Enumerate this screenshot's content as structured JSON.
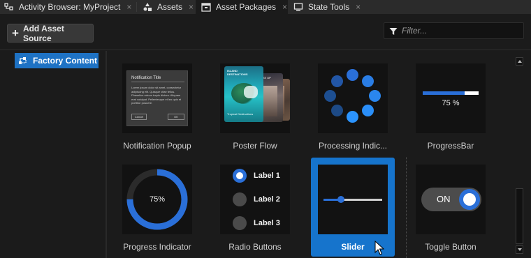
{
  "tabs": [
    {
      "label": "Activity Browser: MyProject",
      "icon": "activity-icon",
      "active": false
    },
    {
      "label": "Assets",
      "icon": "assets-icon",
      "active": false
    },
    {
      "label": "Asset Packages",
      "icon": "package-icon",
      "active": true
    },
    {
      "label": "State Tools",
      "icon": "monitor-icon",
      "active": false
    }
  ],
  "tab_close_glyph": "×",
  "toolbar": {
    "add_label": "Add Asset Source",
    "filter_placeholder": "Filter..."
  },
  "tree": {
    "items": [
      {
        "label": "Factory Content",
        "icon": "factory-content-icon",
        "selected": true
      }
    ]
  },
  "assets": [
    {
      "label": "Notification Popup",
      "selected": false
    },
    {
      "label": "Poster Flow",
      "selected": false
    },
    {
      "label": "Processing Indic...",
      "selected": false
    },
    {
      "label": "ProgressBar",
      "selected": false
    },
    {
      "label": "Progress Indicator",
      "selected": false
    },
    {
      "label": "Radio Buttons",
      "selected": false
    },
    {
      "label": "Slider",
      "selected": true
    },
    {
      "label": "Toggle Button",
      "selected": false
    }
  ],
  "thumbs": {
    "notification": {
      "title": "Notification Title",
      "body": "Lorem ipsum dolor sit amet, consectetur adipiscing elit. Quisque vitae tellus. Phasellus rutrum turpis dictum. Aliquam erat volutpat. Pellentesque et leo quis et porttitor posuere.",
      "cancel": "Cancel",
      "ok": "OK"
    },
    "poster": {
      "title": "ISLAND DESTINATIONS",
      "subtitle": "Tropical Destinations",
      "side_title": "TAKE UP"
    },
    "progressbar": {
      "text": "75 %",
      "value": 0.75
    },
    "progress_indicator": {
      "text": "75%",
      "value": 0.75
    },
    "radios": [
      {
        "label": "Label 1",
        "checked": true
      },
      {
        "label": "Label 2",
        "checked": false
      },
      {
        "label": "Label 3",
        "checked": false
      }
    ],
    "slider": {
      "value": 0.3
    },
    "toggle": {
      "text": "ON",
      "on": true
    }
  },
  "colors": {
    "accent": "#1e72c4",
    "selection": "#1674cc",
    "blue": "#2a6fd8"
  }
}
